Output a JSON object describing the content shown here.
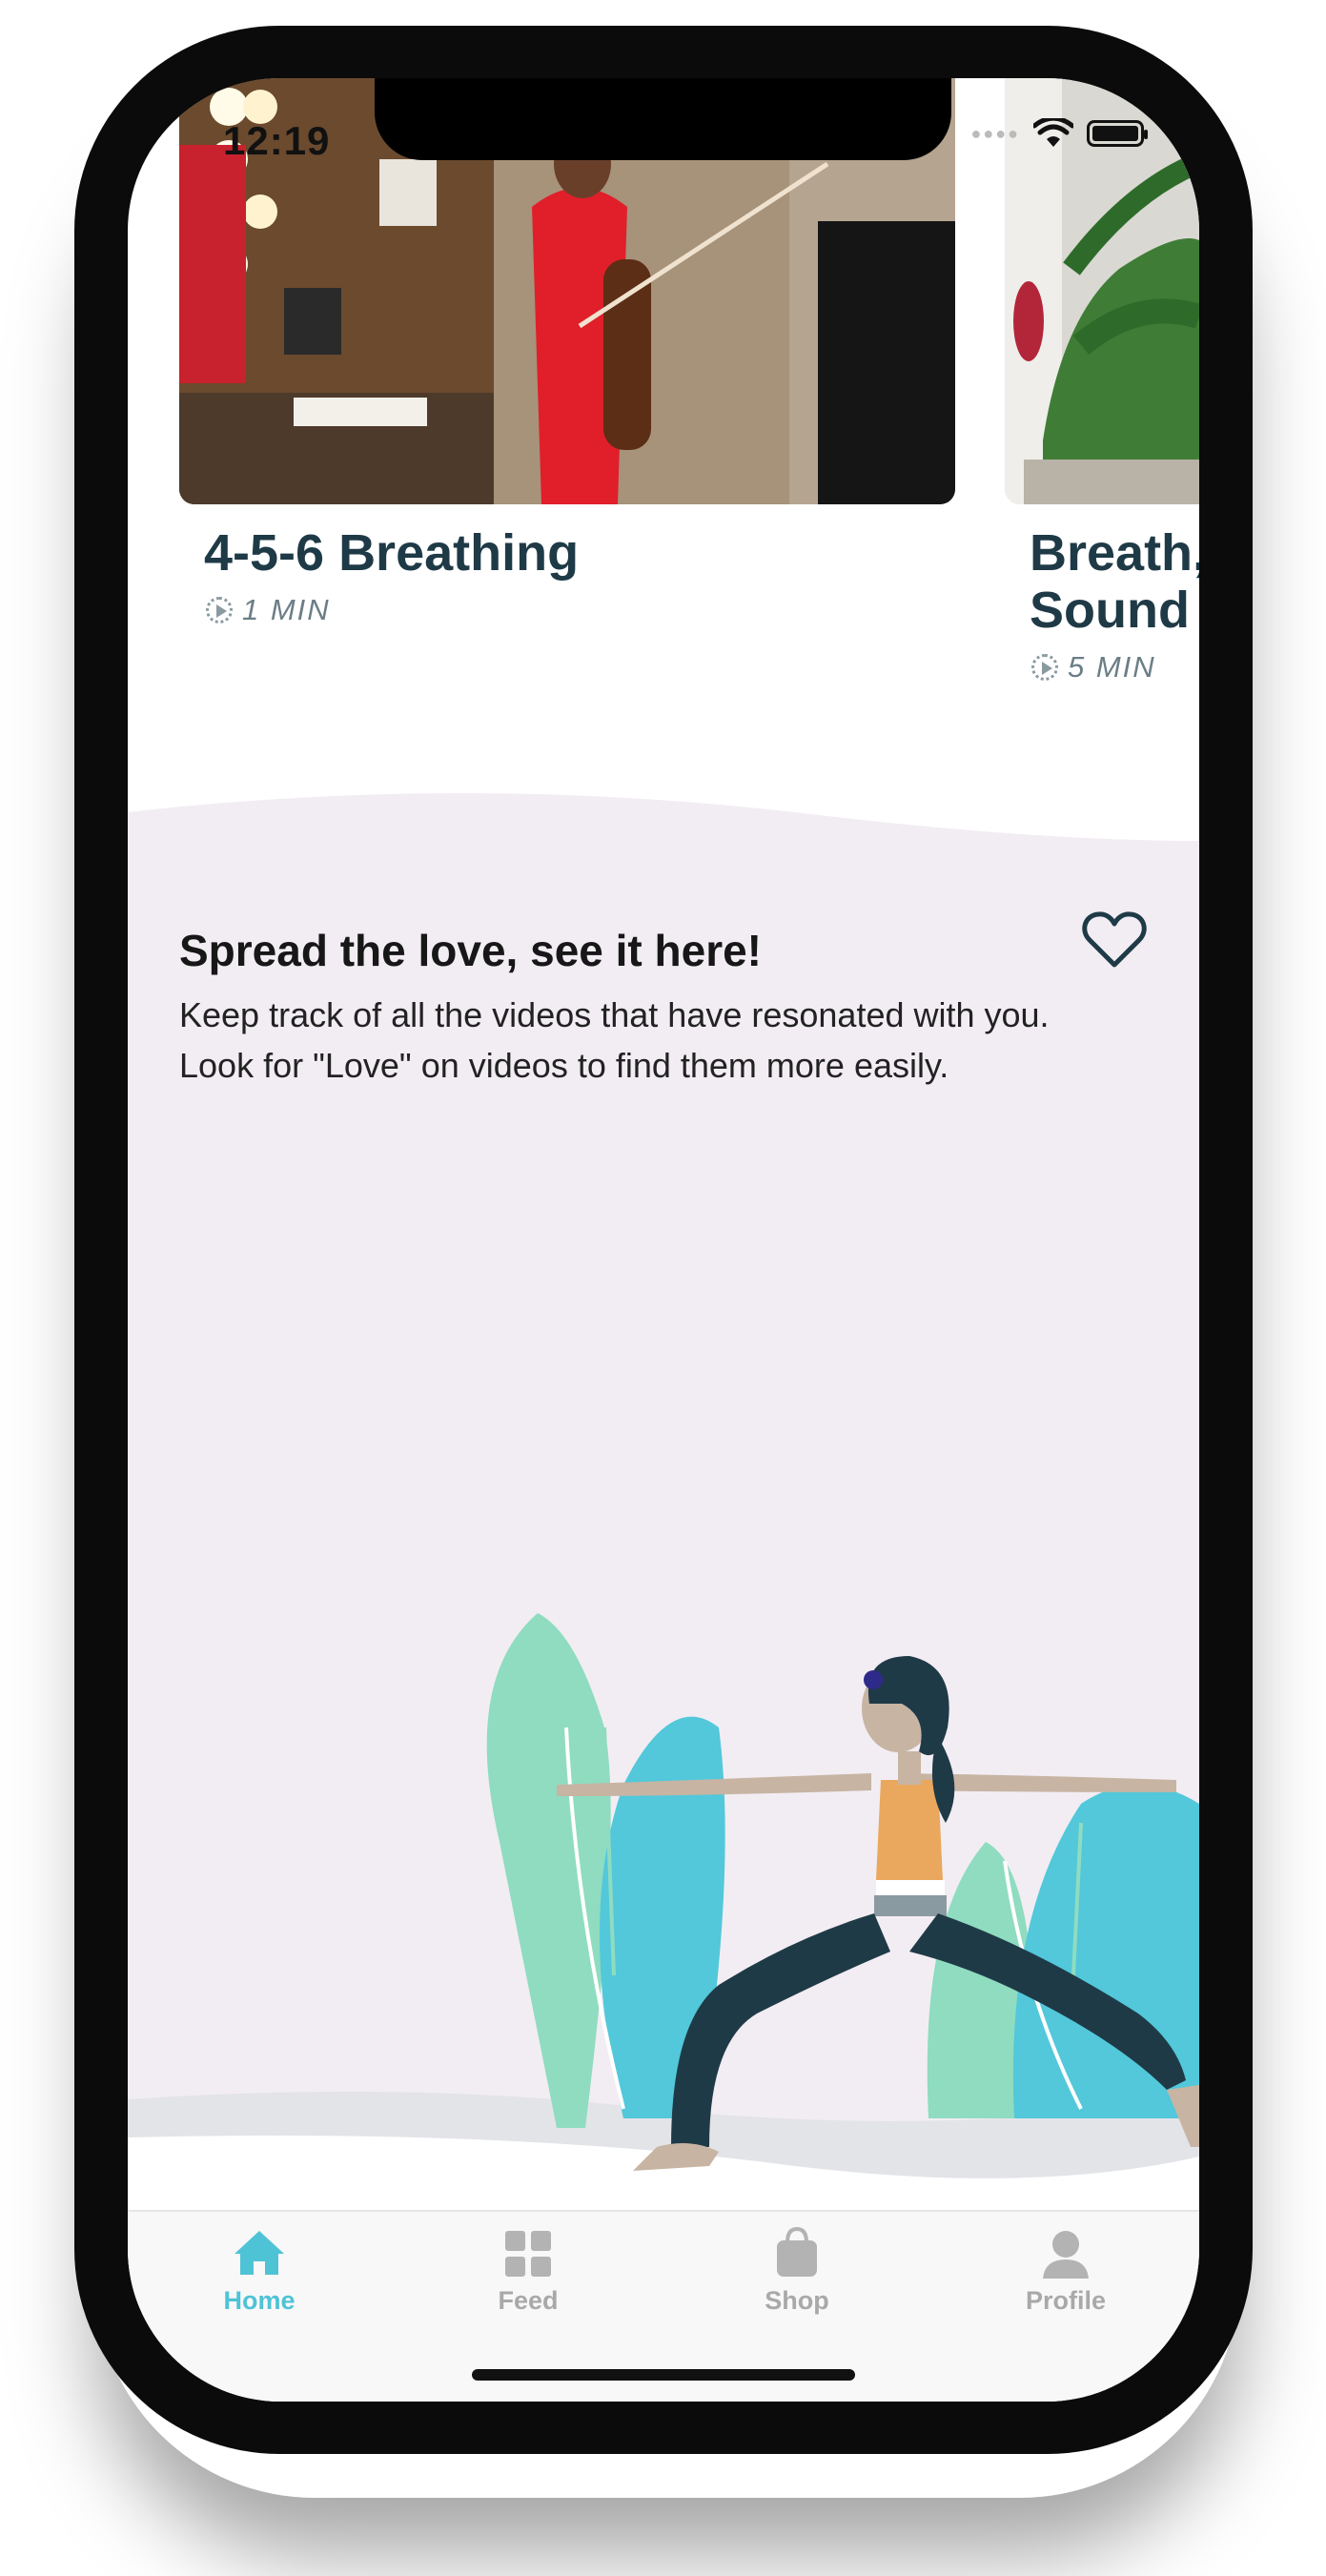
{
  "status_bar": {
    "time": "12:19"
  },
  "videos": [
    {
      "title": "4-5-6 Breathing",
      "duration": "1 MIN"
    },
    {
      "title_line1": "Breath,",
      "title_line2": "Sound",
      "duration": "5 MIN"
    }
  ],
  "love_promo": {
    "title": "Spread the love, see it here!",
    "body": "Keep track of all the videos that have resonated with you. Look for \"Love\" on videos to find them more easily.",
    "icon": "heart-outline-icon"
  },
  "tabbar": {
    "tabs": [
      {
        "label": "Home",
        "icon": "home-icon",
        "active": true
      },
      {
        "label": "Feed",
        "icon": "grid-icon",
        "active": false
      },
      {
        "label": "Shop",
        "icon": "shopping-bag-icon",
        "active": false
      },
      {
        "label": "Profile",
        "icon": "person-icon",
        "active": false
      }
    ]
  },
  "colors": {
    "accent": "#4fc3d6",
    "inactive_tab": "#a9a9a9",
    "title_text": "#1f3a47",
    "promo_background": "#f2edf3"
  }
}
